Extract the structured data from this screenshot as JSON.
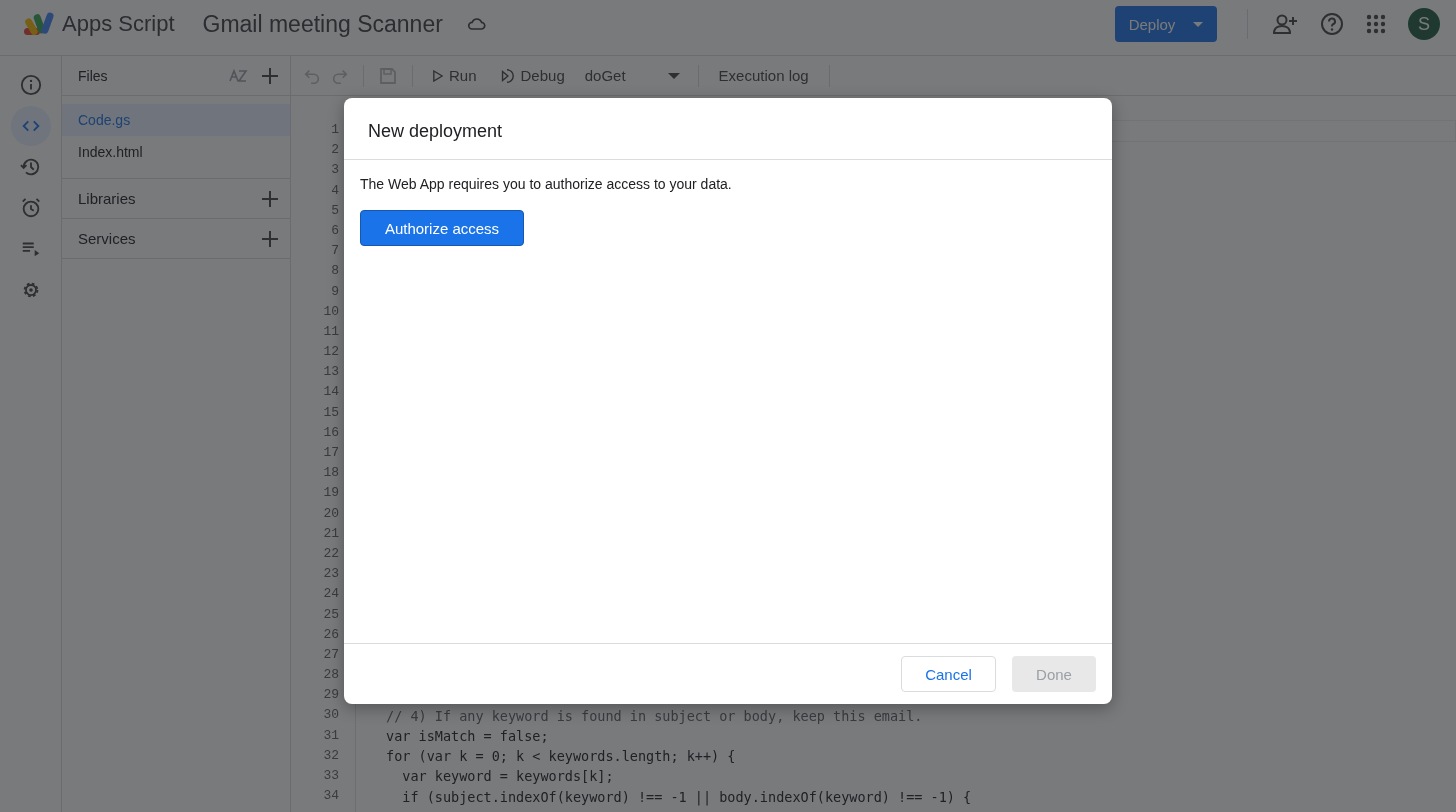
{
  "app": {
    "name": "Apps Script",
    "project_title": "Gmail meeting Scanner"
  },
  "header": {
    "deploy_button": "Deploy",
    "avatar": "S"
  },
  "rail": [
    {
      "kind": "info",
      "selected": false
    },
    {
      "kind": "code",
      "selected": true
    },
    {
      "kind": "history",
      "selected": false
    },
    {
      "kind": "alarm",
      "selected": false
    },
    {
      "kind": "executions",
      "selected": false
    },
    {
      "kind": "settings",
      "selected": false
    }
  ],
  "files_panel": {
    "title": "Files",
    "files": [
      {
        "name": "Code.gs",
        "selected": true
      },
      {
        "name": "Index.html",
        "selected": false
      }
    ],
    "sections": [
      "Libraries",
      "Services"
    ]
  },
  "toolbar": {
    "run": "Run",
    "debug": "Debug",
    "function": "doGet",
    "execution_log": "Execution log"
  },
  "editor": {
    "line_numbers": [
      "1",
      "2",
      "3",
      "4",
      "5",
      "6",
      "7",
      "8",
      "9",
      "10",
      "11",
      "12",
      "13",
      "14",
      "15",
      "16",
      "17",
      "18",
      "19",
      "20",
      "21",
      "22",
      "23",
      "24",
      "25",
      "26",
      "27",
      "28",
      "29",
      "30",
      "31",
      "32",
      "33",
      "34"
    ],
    "visible_lines": [
      {
        "kind": "comment",
        "text": "// 4) If any keyword is found in subject or body, keep this email."
      },
      {
        "kind": "code",
        "text": "var isMatch = false;"
      },
      {
        "kind": "code",
        "text": "for (var k = 0; k < keywords.length; k++) {"
      },
      {
        "kind": "code",
        "text": "  var keyword = keywords[k];"
      },
      {
        "kind": "code",
        "text": "  if (subject.indexOf(keyword) !== -1 || body.indexOf(keyword) !== -1) {"
      }
    ]
  },
  "dialog": {
    "title": "New deployment",
    "message": "The Web App requires you to authorize access to your data.",
    "authorize_button": "Authorize access",
    "cancel_button": "Cancel",
    "done_button": {
      "label": "Done",
      "disabled": true
    }
  }
}
